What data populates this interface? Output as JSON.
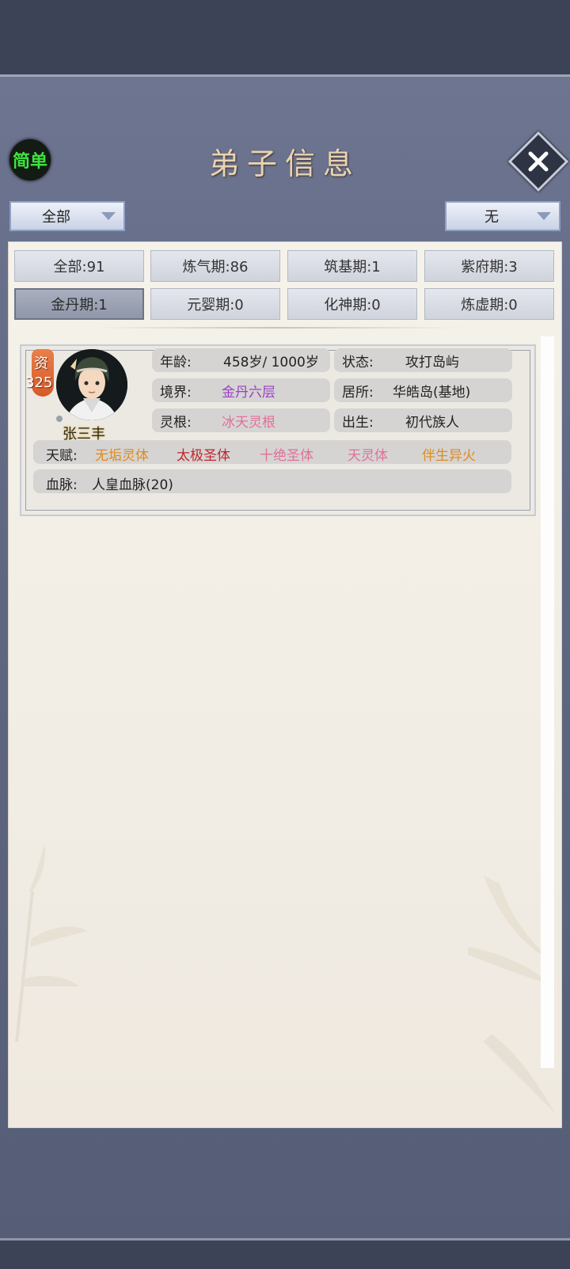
{
  "header": {
    "simple_mode_label": "简单",
    "title": "弟子信息"
  },
  "filters": {
    "left_dropdown": "全部",
    "right_dropdown": "无"
  },
  "stage_tabs": [
    {
      "label": "全部:91"
    },
    {
      "label": "炼气期:86"
    },
    {
      "label": "筑基期:1"
    },
    {
      "label": "紫府期:3"
    },
    {
      "label": "金丹期:1",
      "active": true
    },
    {
      "label": "元婴期:0"
    },
    {
      "label": "化神期:0"
    },
    {
      "label": "炼虚期:0"
    }
  ],
  "disciple": {
    "talent_label": "资",
    "talent_value": "325",
    "name": "张三丰",
    "age_key": "年龄:",
    "age_value": "458岁/ 1000岁",
    "status_key": "状态:",
    "status_value": "攻打岛屿",
    "realm_key": "境界:",
    "realm_value": "金丹六层",
    "residence_key": "居所:",
    "residence_value": "华皓岛(基地)",
    "root_key": "灵根:",
    "root_value": "冰天灵根",
    "birth_key": "出生:",
    "birth_value": "初代族人",
    "gifts_key": "天赋:",
    "gifts": [
      {
        "label": "无垢灵体",
        "color": "#e08a1e"
      },
      {
        "label": "太极圣体",
        "color": "#c0262c"
      },
      {
        "label": "十绝圣体",
        "color": "#e0709a"
      },
      {
        "label": "天灵体",
        "color": "#e0709a"
      },
      {
        "label": "伴生异火",
        "color": "#e08a1e"
      }
    ],
    "bloodline_key": "血脉:",
    "bloodline_value": "人皇血脉(20)"
  },
  "colors": {
    "realm": "#9b3fc9",
    "root": "#e0709a",
    "simple_mode": "#3ee33e",
    "title": "#e9d3b3"
  },
  "icons": {
    "close": "close-x-icon",
    "dropdown_arrow": "triangle-down-icon"
  }
}
